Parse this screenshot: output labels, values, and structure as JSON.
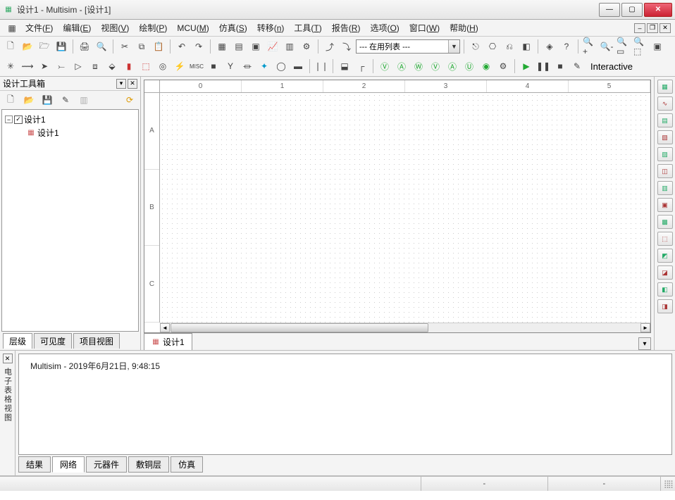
{
  "title": "设计1 - Multisim - [设计1]",
  "menus": [
    {
      "label": "文件",
      "key": "F"
    },
    {
      "label": "编辑",
      "key": "E"
    },
    {
      "label": "视图",
      "key": "V"
    },
    {
      "label": "绘制",
      "key": "P"
    },
    {
      "label": "MCU",
      "key": "M"
    },
    {
      "label": "仿真",
      "key": "S"
    },
    {
      "label": "转移",
      "key": "n"
    },
    {
      "label": "工具",
      "key": "T"
    },
    {
      "label": "报告",
      "key": "R"
    },
    {
      "label": "选项",
      "key": "O"
    },
    {
      "label": "窗口",
      "key": "W"
    },
    {
      "label": "帮助",
      "key": "H"
    }
  ],
  "combo_value": "--- 在用列表 ---",
  "interactive_label": "Interactive",
  "sidebar": {
    "title": "设计工具箱",
    "root": "设计1",
    "child": "设计1",
    "tabs": [
      "层级",
      "可见度",
      "项目视图"
    ],
    "active_tab": 0
  },
  "ruler_h": [
    "0",
    "1",
    "2",
    "3",
    "4",
    "5"
  ],
  "ruler_v": [
    "A",
    "B",
    "C"
  ],
  "doc_tab": "设计1",
  "output": {
    "side_label": "电子表格视图",
    "text": "Multisim  -  2019年6月21日, 9:48:15",
    "tabs": [
      "结果",
      "网络",
      "元器件",
      "敷铜层",
      "仿真"
    ],
    "active_tab": 1
  },
  "status": {
    "c1": "",
    "c2": "-",
    "c3": "-"
  }
}
